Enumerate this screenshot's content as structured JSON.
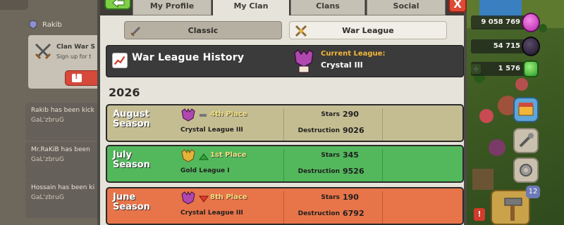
{
  "chat": {
    "user": "Rakib",
    "clan_war": {
      "title": "Clan War S",
      "subtitle": "Sign up for t"
    },
    "messages": [
      {
        "line1": "Rakib has been kick",
        "line2": "GaL'zbruG"
      },
      {
        "line1": "Mr.RaKiB has been",
        "line2": "GaL'zbruG"
      },
      {
        "line1": "Hossain has been ki",
        "line2": "GaL'zbruG"
      }
    ]
  },
  "tabs": [
    {
      "label": "My Profile"
    },
    {
      "label": "My Clan"
    },
    {
      "label": "Clans"
    },
    {
      "label": "Social"
    }
  ],
  "close_label": "X",
  "sub_tabs": {
    "classic": "Classic",
    "war_league": "War League"
  },
  "history": {
    "title": "War League History",
    "current_label": "Current League:",
    "current_value": "Crystal III"
  },
  "year": "2026",
  "seasons": [
    {
      "name_line1": "August",
      "name_line2": "Season",
      "place": "4th Place",
      "place_trend": "same",
      "league": "Crystal League III",
      "stars_label": "Stars",
      "stars": "290",
      "destruction_label": "Destruction",
      "destruction": "9026"
    },
    {
      "name_line1": "July",
      "name_line2": "Season",
      "place": "1st Place",
      "place_trend": "up",
      "league": "Gold League I",
      "stars_label": "Stars",
      "stars": "345",
      "destruction_label": "Destruction",
      "destruction": "9526"
    },
    {
      "name_line1": "June",
      "name_line2": "Season",
      "place": "8th Place",
      "place_trend": "down",
      "league": "Crystal League III",
      "stars_label": "Stars",
      "stars": "190",
      "destruction_label": "Destruction",
      "destruction": "6792"
    }
  ],
  "resources": {
    "elixir": "9 058 769",
    "dark_elixir": "54 715",
    "gems": "1 576"
  },
  "builder_badge": "12",
  "alert": "!",
  "colors": {
    "august": "#c5bd92",
    "july": "#53b85c",
    "june": "#e87449",
    "current_label": "#f3b83a",
    "place_gold": "#f2e27a",
    "place_up": "#2fa23a",
    "place_down": "#e23b2b"
  }
}
